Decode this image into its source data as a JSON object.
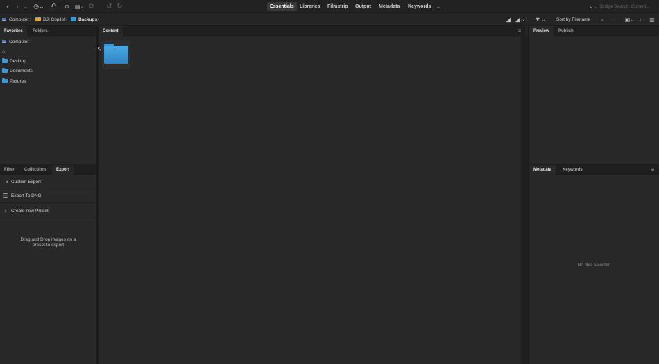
{
  "toolbar": {
    "workspaces": [
      {
        "label": "Essentials",
        "active": true
      },
      {
        "label": "Libraries",
        "active": false
      },
      {
        "label": "Filmstrip",
        "active": false
      },
      {
        "label": "Output",
        "active": false
      },
      {
        "label": "Metadata",
        "active": false
      },
      {
        "label": "Keywords",
        "active": false
      }
    ],
    "search_placeholder": "Bridge Search: Current..."
  },
  "pathbar": {
    "crumbs": [
      "Computer",
      "DJI Copilot",
      "Backups"
    ],
    "sort_label": "Sort by Filename"
  },
  "left_top": {
    "tabs": [
      "Favorites",
      "Folders"
    ],
    "items": [
      {
        "label": "Computer",
        "icon": "computer-icon"
      },
      {
        "label": "",
        "icon": "home-icon"
      },
      {
        "label": "Desktop",
        "icon": "folder-icon"
      },
      {
        "label": "Documents",
        "icon": "folder-icon"
      },
      {
        "label": "Pictures",
        "icon": "folder-icon"
      }
    ]
  },
  "left_bottom": {
    "tabs": [
      "Filter",
      "Collections",
      "Export"
    ],
    "rows": [
      {
        "label": "Custom Export",
        "icon": "export-icon"
      },
      {
        "label": "Export To DNG",
        "icon": "list-icon"
      },
      {
        "label": "Create new Preset",
        "icon": "plus-icon"
      }
    ],
    "hint_line1": "Drag and Drop images on a",
    "hint_line2": "preset to export"
  },
  "content": {
    "tab": "Content"
  },
  "right_top": {
    "tabs": [
      "Preview",
      "Publish"
    ]
  },
  "right_bottom": {
    "tabs": [
      "Metadata",
      "Keywords"
    ],
    "empty_text": "No files selected"
  },
  "colors": {
    "accent_folder": "#3a9ad9",
    "panel_bg": "#282828",
    "header_bg": "#1f1f1f"
  }
}
